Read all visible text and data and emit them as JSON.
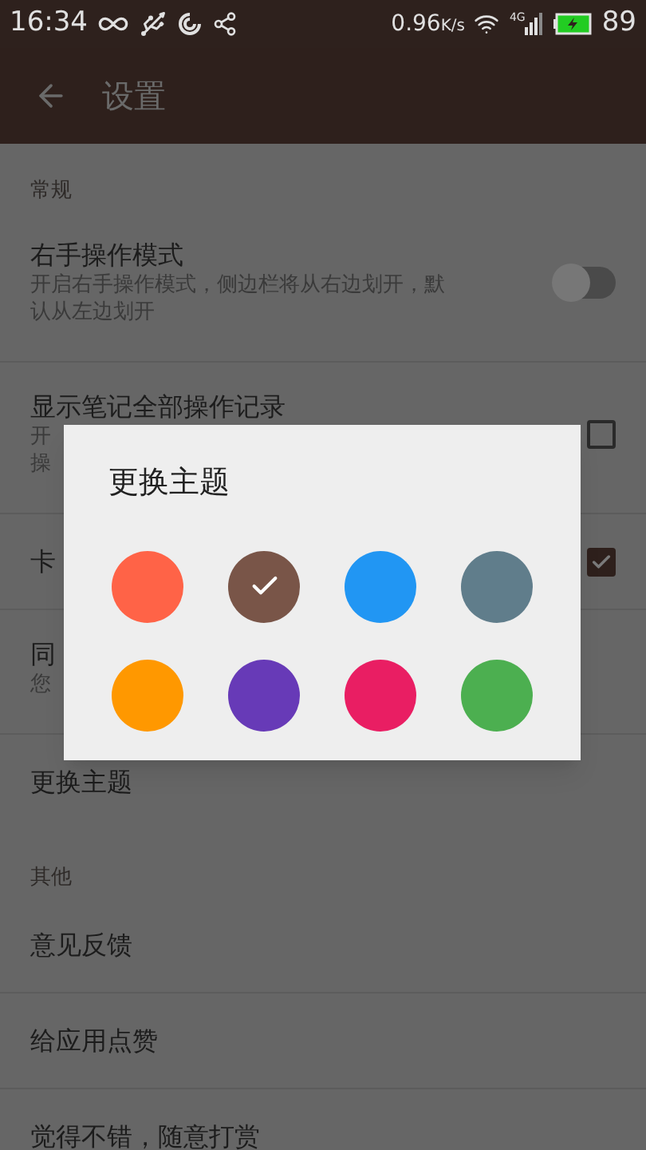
{
  "status_bar": {
    "time": "16:34",
    "speed": "0.96",
    "speed_unit": "K/s",
    "network": "4G",
    "battery": "89"
  },
  "toolbar": {
    "title": "设置"
  },
  "sections": [
    {
      "header": "常规",
      "items": [
        {
          "kind": "switch",
          "title": "右手操作模式",
          "subtitle": [
            "开启右手操作模式，侧边栏将从右边划开，默",
            "认从左边划开"
          ],
          "on": false
        },
        {
          "kind": "checkbox",
          "title": "显示笔记全部操作记录",
          "subtitle": [
            "开",
            "操"
          ],
          "checked": false
        },
        {
          "kind": "checkbox",
          "title": "卡",
          "checked": true
        },
        {
          "kind": "plain",
          "title": "同",
          "subtitle": [
            "您"
          ]
        },
        {
          "kind": "plain",
          "title": "更换主题"
        }
      ]
    },
    {
      "header": "其他",
      "items": [
        {
          "kind": "plain",
          "title": "意见反馈"
        },
        {
          "kind": "plain",
          "title": "给应用点赞"
        },
        {
          "kind": "plain",
          "title": "觉得不错，随意打赏"
        }
      ]
    }
  ],
  "dialog": {
    "title": "更换主题",
    "colors": [
      {
        "color": "#ff6347",
        "selected": false
      },
      {
        "color": "#795548",
        "selected": true
      },
      {
        "color": "#2196f3",
        "selected": false
      },
      {
        "color": "#607d8b",
        "selected": false
      },
      {
        "color": "#ff9800",
        "selected": false
      },
      {
        "color": "#673ab7",
        "selected": false
      },
      {
        "color": "#e91e63",
        "selected": false
      },
      {
        "color": "#4caf50",
        "selected": false
      }
    ]
  }
}
